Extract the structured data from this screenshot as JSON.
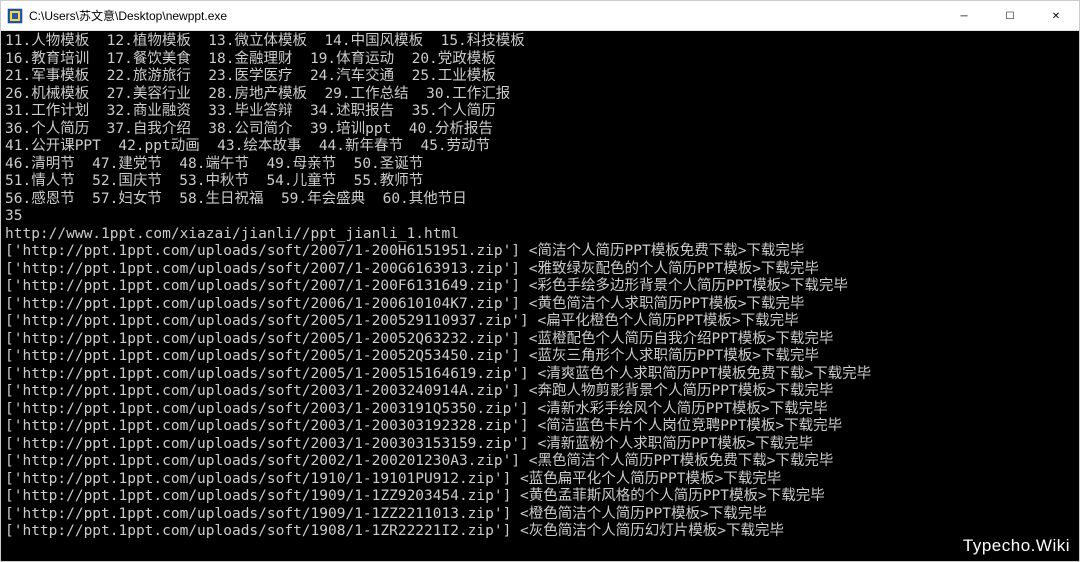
{
  "window": {
    "title": "C:\\Users\\苏文意\\Desktop\\newppt.exe",
    "controls": {
      "minimize": "─",
      "maximize": "☐",
      "close": "✕"
    }
  },
  "watermark": "Typecho.Wiki",
  "categories": [
    [
      {
        "n": "11",
        "label": "人物模板"
      },
      {
        "n": "12",
        "label": "植物模板"
      },
      {
        "n": "13",
        "label": "微立体模板"
      },
      {
        "n": "14",
        "label": "中国风模板"
      },
      {
        "n": "15",
        "label": "科技模板"
      }
    ],
    [
      {
        "n": "16",
        "label": "教育培训"
      },
      {
        "n": "17",
        "label": "餐饮美食"
      },
      {
        "n": "18",
        "label": "金融理财"
      },
      {
        "n": "19",
        "label": "体育运动"
      },
      {
        "n": "20",
        "label": "党政模板"
      }
    ],
    [
      {
        "n": "21",
        "label": "军事模板"
      },
      {
        "n": "22",
        "label": "旅游旅行"
      },
      {
        "n": "23",
        "label": "医学医疗"
      },
      {
        "n": "24",
        "label": "汽车交通"
      },
      {
        "n": "25",
        "label": "工业模板"
      }
    ],
    [
      {
        "n": "26",
        "label": "机械模板"
      },
      {
        "n": "27",
        "label": "美容行业"
      },
      {
        "n": "28",
        "label": "房地产模板"
      },
      {
        "n": "29",
        "label": "工作总结"
      },
      {
        "n": "30",
        "label": "工作汇报"
      }
    ],
    [
      {
        "n": "31",
        "label": "工作计划"
      },
      {
        "n": "32",
        "label": "商业融资"
      },
      {
        "n": "33",
        "label": "毕业答辩"
      },
      {
        "n": "34",
        "label": "述职报告"
      },
      {
        "n": "35",
        "label": "个人简历"
      }
    ],
    [
      {
        "n": "36",
        "label": "个人简历"
      },
      {
        "n": "37",
        "label": "自我介绍"
      },
      {
        "n": "38",
        "label": "公司简介"
      },
      {
        "n": "39",
        "label": "培训ppt"
      },
      {
        "n": "40",
        "label": "分析报告"
      }
    ],
    [
      {
        "n": "41",
        "label": "公开课PPT"
      },
      {
        "n": "42",
        "label": "ppt动画"
      },
      {
        "n": "43",
        "label": "绘本故事"
      },
      {
        "n": "44",
        "label": "新年春节"
      },
      {
        "n": "45",
        "label": "劳动节"
      }
    ],
    [
      {
        "n": "46",
        "label": "清明节"
      },
      {
        "n": "47",
        "label": "建党节"
      },
      {
        "n": "48",
        "label": "端午节"
      },
      {
        "n": "49",
        "label": "母亲节"
      },
      {
        "n": "50",
        "label": "圣诞节"
      }
    ],
    [
      {
        "n": "51",
        "label": "情人节"
      },
      {
        "n": "52",
        "label": "国庆节"
      },
      {
        "n": "53",
        "label": "中秋节"
      },
      {
        "n": "54",
        "label": "儿童节"
      },
      {
        "n": "55",
        "label": "教师节"
      }
    ],
    [
      {
        "n": "56",
        "label": "感恩节"
      },
      {
        "n": "57",
        "label": "妇女节"
      },
      {
        "n": "58",
        "label": "生日祝福"
      },
      {
        "n": "59",
        "label": "年会盛典"
      },
      {
        "n": "60",
        "label": "其他节日"
      }
    ]
  ],
  "input": "35",
  "page_url": "http://www.1ppt.com/xiazai/jianli//ppt_jianli_1.html",
  "downloads": [
    {
      "url": "http://ppt.1ppt.com/uploads/soft/2007/1-200H6151951.zip",
      "desc": "简洁个人简历PPT模板免费下载",
      "status": "下载完毕"
    },
    {
      "url": "http://ppt.1ppt.com/uploads/soft/2007/1-200G6163913.zip",
      "desc": "雅致绿灰配色的个人简历PPT模板",
      "status": "下载完毕"
    },
    {
      "url": "http://ppt.1ppt.com/uploads/soft/2007/1-200F6131649.zip",
      "desc": "彩色手绘多边形背景个人简历PPT模板",
      "status": "下载完毕"
    },
    {
      "url": "http://ppt.1ppt.com/uploads/soft/2006/1-200610104K7.zip",
      "desc": "黄色简洁个人求职简历PPT模板",
      "status": "下载完毕"
    },
    {
      "url": "http://ppt.1ppt.com/uploads/soft/2005/1-200529110937.zip",
      "desc": "扁平化橙色个人简历PPT模板",
      "status": "下载完毕"
    },
    {
      "url": "http://ppt.1ppt.com/uploads/soft/2005/1-20052Q63232.zip",
      "desc": "蓝橙配色个人简历自我介绍PPT模板",
      "status": "下载完毕"
    },
    {
      "url": "http://ppt.1ppt.com/uploads/soft/2005/1-20052Q53450.zip",
      "desc": "蓝灰三角形个人求职简历PPT模板",
      "status": "下载完毕"
    },
    {
      "url": "http://ppt.1ppt.com/uploads/soft/2005/1-200515164619.zip",
      "desc": "清爽蓝色个人求职简历PPT模板免费下载",
      "status": "下载完毕"
    },
    {
      "url": "http://ppt.1ppt.com/uploads/soft/2003/1-2003240914A.zip",
      "desc": "奔跑人物剪影背景个人简历PPT模板",
      "status": "下载完毕"
    },
    {
      "url": "http://ppt.1ppt.com/uploads/soft/2003/1-2003191Q5350.zip",
      "desc": "清新水彩手绘风个人简历PPT模板",
      "status": "下载完毕"
    },
    {
      "url": "http://ppt.1ppt.com/uploads/soft/2003/1-200303192328.zip",
      "desc": "简洁蓝色卡片个人岗位竞聘PPT模板",
      "status": "下载完毕"
    },
    {
      "url": "http://ppt.1ppt.com/uploads/soft/2003/1-200303153159.zip",
      "desc": "清新蓝粉个人求职简历PPT模板",
      "status": "下载完毕"
    },
    {
      "url": "http://ppt.1ppt.com/uploads/soft/2002/1-200201230A3.zip",
      "desc": "黑色简洁个人简历PPT模板免费下载",
      "status": "下载完毕"
    },
    {
      "url": "http://ppt.1ppt.com/uploads/soft/1910/1-19101PU912.zip",
      "desc": "蓝色扁平化个人简历PPT模板",
      "status": "下载完毕"
    },
    {
      "url": "http://ppt.1ppt.com/uploads/soft/1909/1-1ZZ9203454.zip",
      "desc": "黄色孟菲斯风格的个人简历PPT模板",
      "status": "下载完毕"
    },
    {
      "url": "http://ppt.1ppt.com/uploads/soft/1909/1-1ZZ2211013.zip",
      "desc": "橙色简洁个人简历PPT模板",
      "status": "下载完毕"
    },
    {
      "url": "http://ppt.1ppt.com/uploads/soft/1908/1-1ZR22221I2.zip",
      "desc": "灰色简洁个人简历幻灯片模板",
      "status": "下载完毕"
    }
  ]
}
